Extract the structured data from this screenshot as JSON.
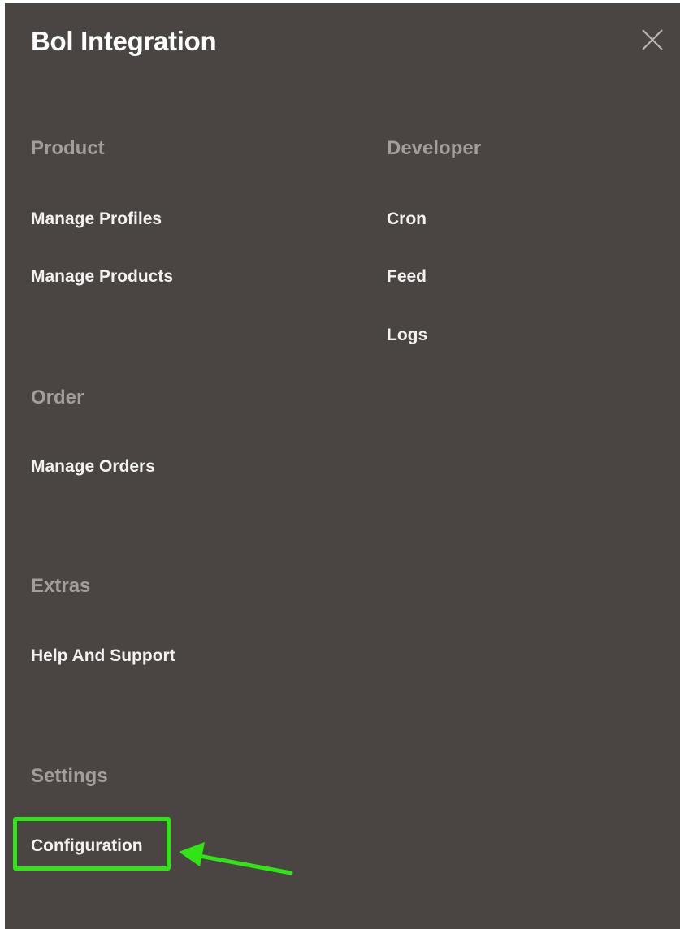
{
  "panel": {
    "title": "Bol Integration",
    "close_icon": "close-icon"
  },
  "sections": {
    "product": {
      "heading": "Product",
      "items": [
        "Manage Profiles",
        "Manage Products"
      ]
    },
    "developer": {
      "heading": "Developer",
      "items": [
        "Cron",
        "Feed",
        "Logs"
      ]
    },
    "order": {
      "heading": "Order",
      "items": [
        "Manage Orders"
      ]
    },
    "extras": {
      "heading": "Extras",
      "items": [
        "Help And Support"
      ]
    },
    "settings": {
      "heading": "Settings",
      "items": [
        "Configuration"
      ]
    }
  },
  "colors": {
    "panel_background": "#4a4542",
    "heading": "#a39e99",
    "link": "#f4f2f0",
    "annotation_highlight": "#2fe515"
  },
  "annotation": {
    "highlight_target": "Configuration",
    "arrow_icon": "left-arrow-icon"
  }
}
